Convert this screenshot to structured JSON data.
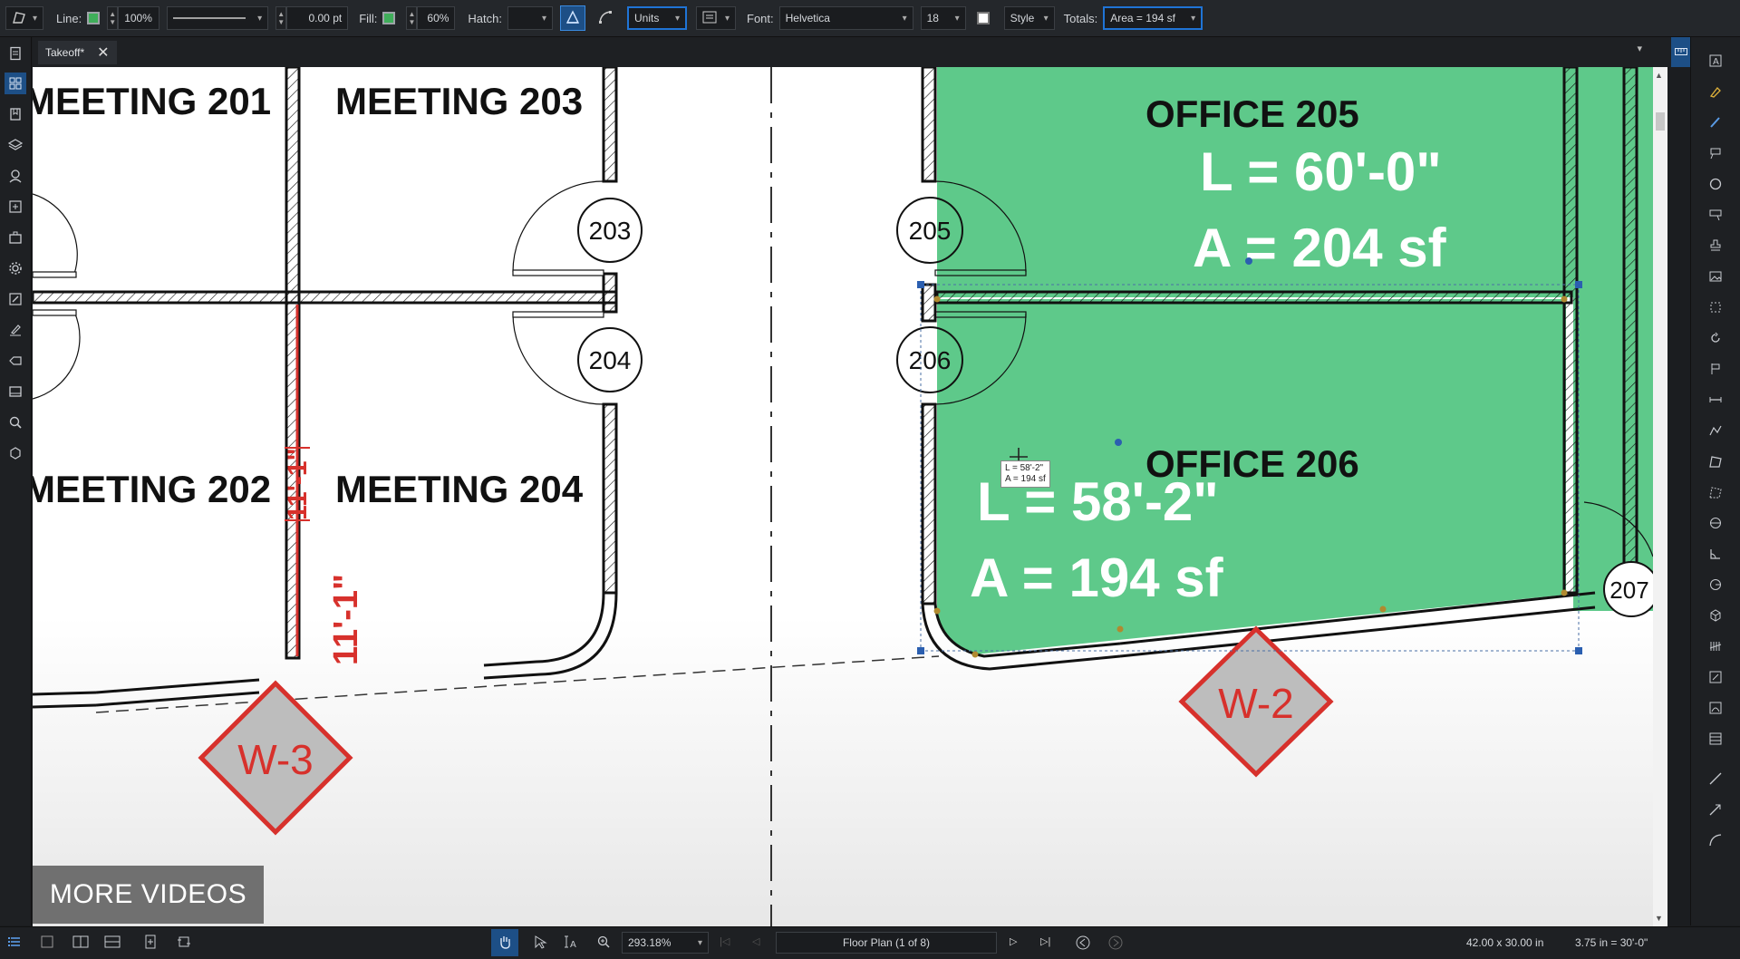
{
  "toolbar": {
    "line_label": "Line:",
    "line_color": "#3fae5a",
    "line_opacity": "100%",
    "line_width": "0.00 pt",
    "fill_label": "Fill:",
    "fill_color": "#3fae5a",
    "fill_opacity": "60%",
    "hatch_label": "Hatch:",
    "units_label": "Units",
    "font_label": "Font:",
    "font_value": "Helvetica",
    "font_size": "18",
    "style_label": "Style",
    "totals_label": "Totals:",
    "totals_value": "Area = 194 sf"
  },
  "tabs": [
    {
      "label": "Takeoff*"
    }
  ],
  "drawing": {
    "rooms": {
      "meeting_201": "MEETING 201",
      "meeting_203": "MEETING 203",
      "meeting_202": "MEETING 202",
      "meeting_204": "MEETING 204",
      "office_205": "OFFICE 205",
      "office_206": "OFFICE 206"
    },
    "door_tags": [
      "203",
      "204",
      "205",
      "206",
      "207"
    ],
    "office_205_length": "L = 60'-0\"",
    "office_205_area": "A = 204 sf",
    "office_206_length": "L = 58'-2\"",
    "office_206_area": "A = 194 sf",
    "dimension_vertical": "11'-1\"",
    "dimension_overlay": "11'-1\"",
    "tooltip_length": "L = 58'-2\"",
    "tooltip_area": "A = 194 sf",
    "window_tags": [
      "W-3",
      "W-2"
    ],
    "fill_color": "#5ec98a",
    "red_color": "#d7312c"
  },
  "overlay": {
    "more_videos": "MORE VIDEOS"
  },
  "status": {
    "zoom": "293.18%",
    "page": "Floor Plan (1 of 8)",
    "page_size": "42.00 x 30.00 in",
    "scale": "3.75 in = 30'-0\""
  }
}
